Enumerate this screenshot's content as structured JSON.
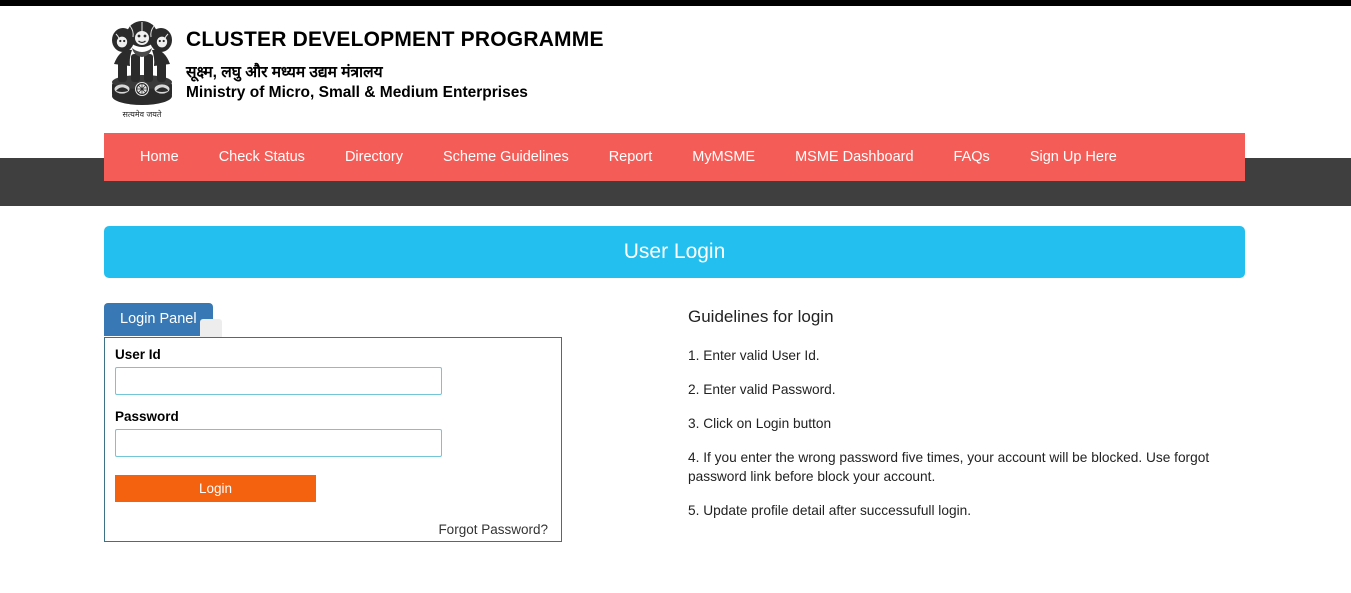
{
  "header": {
    "emblem_icon": "ashoka-lion-capital-emblem",
    "emblem_motto": "सत्यमेव जयते",
    "title": "CLUSTER DEVELOPMENT PROGRAMME",
    "ministry_hindi": "सूक्ष्म, लघु और मध्यम उद्यम मंत्रालय",
    "ministry_english": "Ministry of Micro, Small & Medium Enterprises"
  },
  "nav": {
    "items": [
      {
        "label": "Home"
      },
      {
        "label": "Check Status"
      },
      {
        "label": "Directory"
      },
      {
        "label": "Scheme Guidelines"
      },
      {
        "label": "Report"
      },
      {
        "label": "MyMSME"
      },
      {
        "label": "MSME Dashboard"
      },
      {
        "label": "FAQs"
      },
      {
        "label": "Sign Up Here"
      }
    ]
  },
  "banner": {
    "title": "User Login"
  },
  "login_panel": {
    "tab_label": "Login Panel",
    "user_id_label": "User Id",
    "user_id_value": "",
    "user_id_placeholder": "",
    "password_label": "Password",
    "password_value": "",
    "password_placeholder": "",
    "login_button": "Login",
    "forgot_password": "Forgot Password?"
  },
  "guidelines": {
    "heading": "Guidelines for login",
    "items": [
      "1. Enter valid User Id.",
      "2. Enter valid Password.",
      "3. Click on Login button",
      "4. If you enter the wrong password five times, your account will be blocked. Use forgot password link before block your account.",
      "5. Update profile detail after successufull login."
    ]
  },
  "colors": {
    "nav_red": "#f45d57",
    "dark_strip": "#3f3f3f",
    "banner_cyan": "#23bfee",
    "tab_blue": "#3878b4",
    "login_orange": "#f4610f",
    "input_border": "#73c5d8",
    "box_border": "#3c7186"
  }
}
